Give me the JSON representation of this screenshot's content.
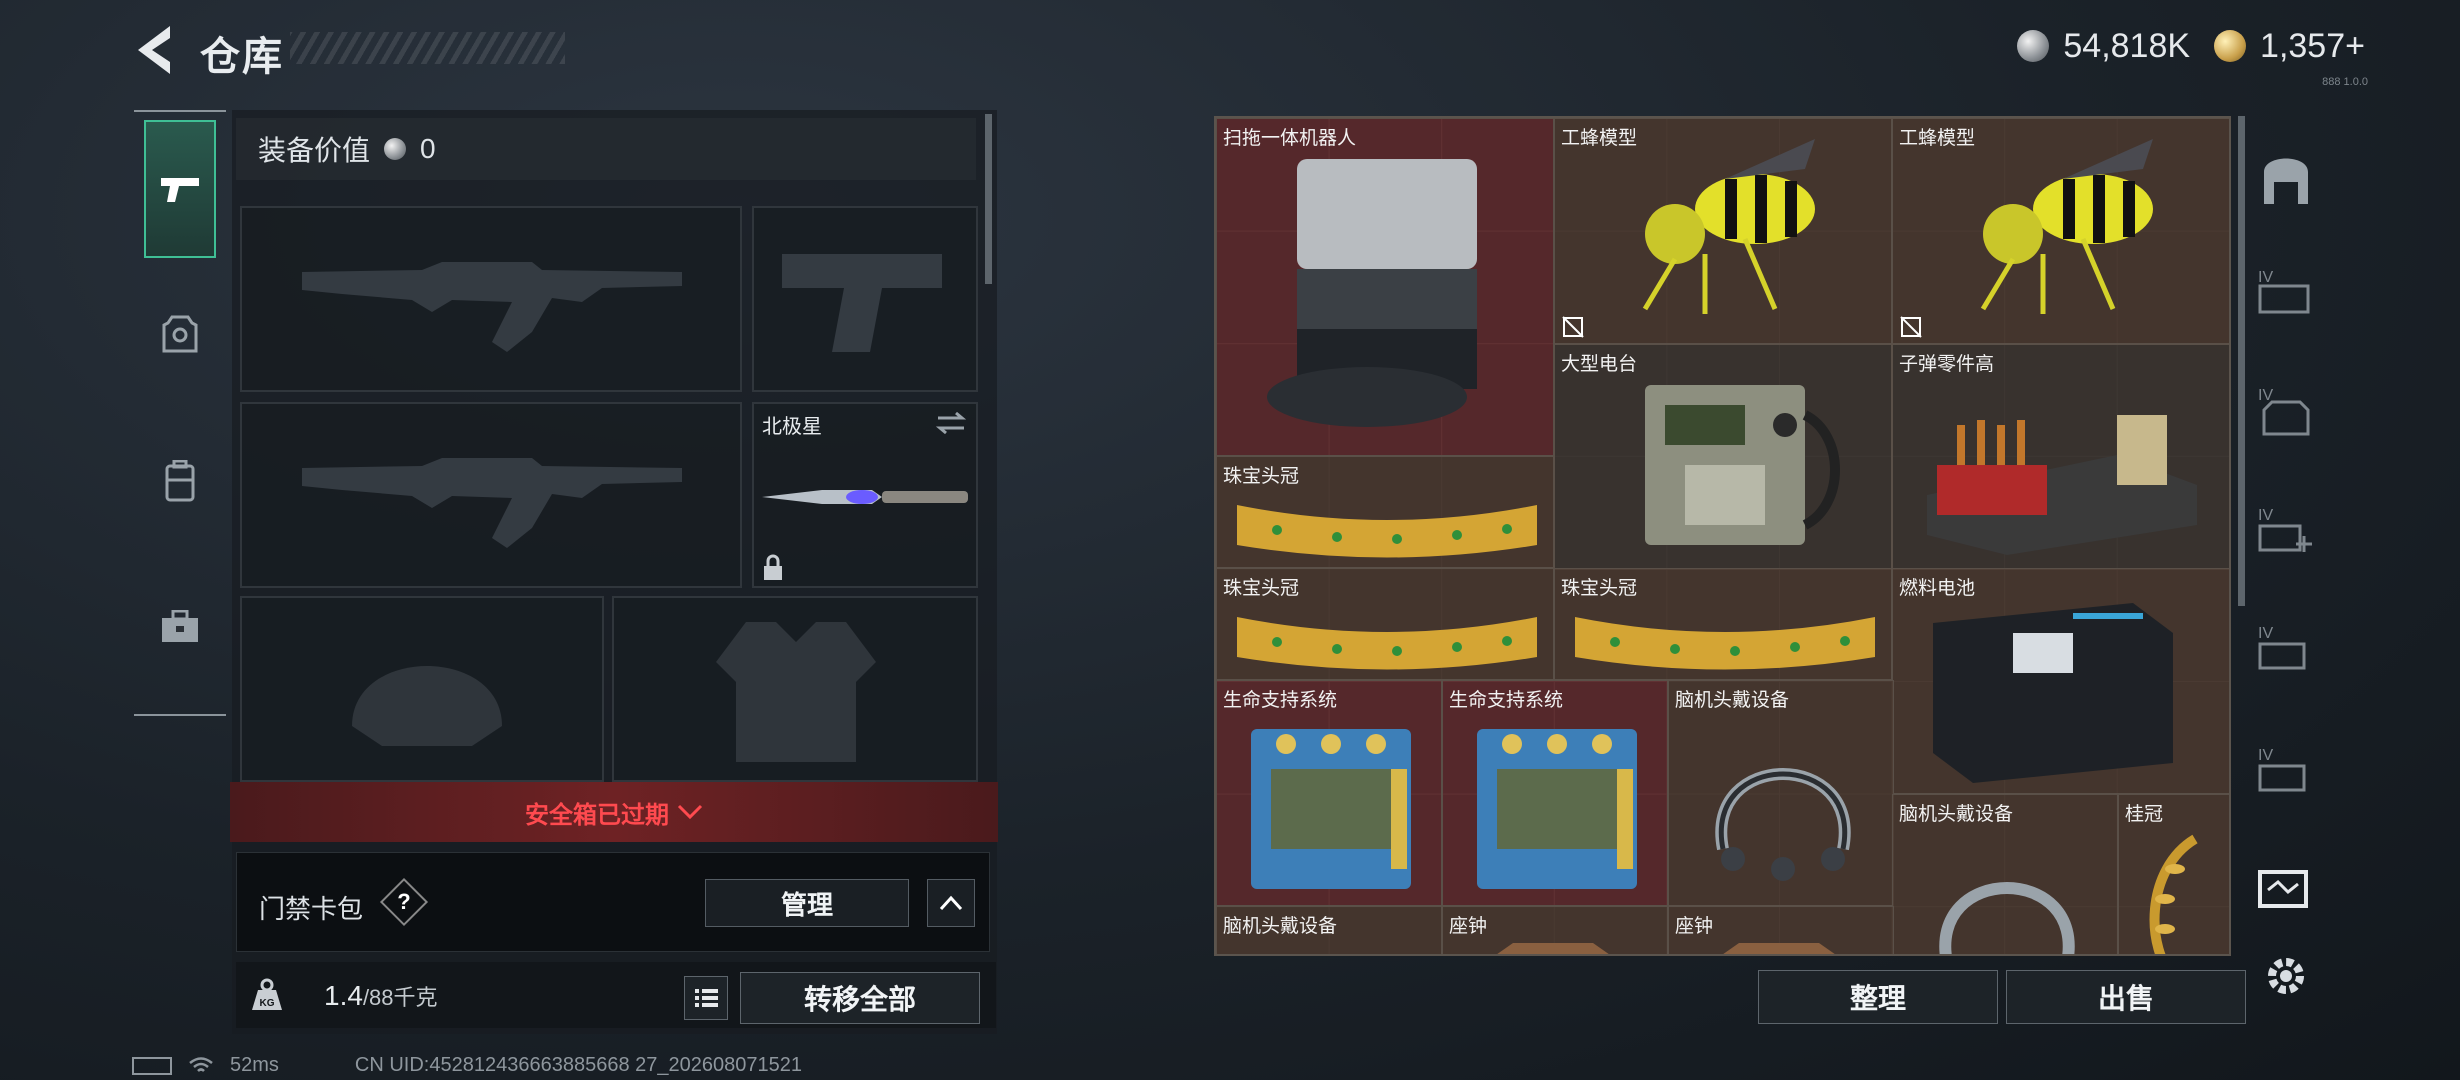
{
  "header": {
    "title": "仓库",
    "currency_silver": "54,818K",
    "currency_gold": "1,357+",
    "version": "888 1.0.0"
  },
  "loadout": {
    "equipment_value_label": "装备价值",
    "equipment_value": "0",
    "melee_name": "北极星",
    "safe_box_status": "安全箱已过期",
    "keycard_bag_label": "门禁卡包",
    "help_icon_text": "?",
    "manage_label": "管理",
    "weight_current": "1.4",
    "weight_max": "/88千克",
    "transfer_all_label": "转移全部",
    "kg_icon_text": "KG"
  },
  "storage": {
    "items": [
      {
        "name": "扫拖一体机器人"
      },
      {
        "name": "工蜂模型"
      },
      {
        "name": "工蜂模型"
      },
      {
        "name": "大型电台"
      },
      {
        "name": "子弹零件高"
      },
      {
        "name": "珠宝头冠"
      },
      {
        "name": "珠宝头冠"
      },
      {
        "name": "珠宝头冠"
      },
      {
        "name": "燃料电池"
      },
      {
        "name": "生命支持系统"
      },
      {
        "name": "生命支持系统"
      },
      {
        "name": "脑机头戴设备"
      },
      {
        "name": "脑机头戴设备"
      },
      {
        "name": "桂冠"
      },
      {
        "name": "脑机头戴设备"
      },
      {
        "name": "座钟"
      },
      {
        "name": "座钟"
      }
    ],
    "sort_label": "整理",
    "sell_label": "出售"
  },
  "footer": {
    "ping": "52ms",
    "uid": "CN UID:452812436663885668 27_202608071521"
  },
  "colors": {
    "accent_green": "#3fbf95",
    "alert_red": "#ff4a4f",
    "grid_bg": "#2c2824"
  }
}
